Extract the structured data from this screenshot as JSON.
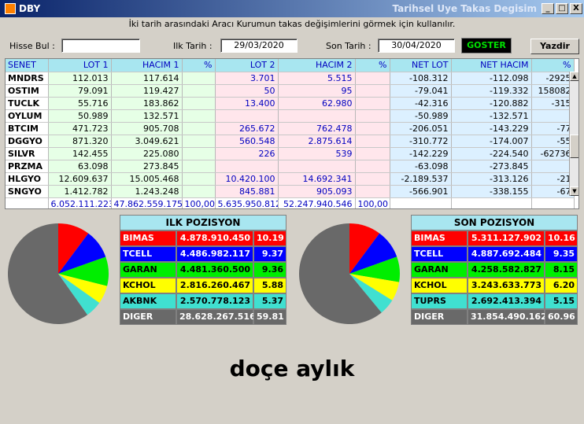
{
  "window": {
    "title": "DBY",
    "right_title": "Tarihsel Uye Takas Degisim",
    "min_label": "_",
    "max_label": "□",
    "close_label": "X"
  },
  "instruction": "İki tarih arasındaki  Aracı Kurumun takas değişimlerini görmek için kullanılır.",
  "controls": {
    "hisse_label": "Hisse Bul :",
    "hisse_value": "",
    "ilk_label": "Ilk Tarih :",
    "ilk_value": "29/03/2020",
    "son_label": "Son Tarih :",
    "son_value": "30/04/2020",
    "goster_label": "GOSTER",
    "yazdir_label": "Yazdir"
  },
  "grid": {
    "headers": [
      "SENET",
      "LOT 1",
      "HACIM 1",
      "%",
      "LOT 2",
      "HACIM 2",
      "%",
      "NET LOT",
      "NET HACIM",
      "%"
    ],
    "rows": [
      [
        "MNDRS",
        "112.013",
        "117.614",
        "",
        "3.701",
        "5.515",
        "",
        "-108.312",
        "-112.098",
        "-2925"
      ],
      [
        "OSTIM",
        "79.091",
        "119.427",
        "",
        "50",
        "95",
        "",
        "-79.041",
        "-119.332",
        "158082"
      ],
      [
        "TUCLK",
        "55.716",
        "183.862",
        "",
        "13.400",
        "62.980",
        "",
        "-42.316",
        "-120.882",
        "-315"
      ],
      [
        "OYLUM",
        "50.989",
        "132.571",
        "",
        "",
        "",
        "",
        "-50.989",
        "-132.571",
        ""
      ],
      [
        "BTCIM",
        "471.723",
        "905.708",
        "",
        "265.672",
        "762.478",
        "",
        "-206.051",
        "-143.229",
        "-77"
      ],
      [
        "DGGYO",
        "871.320",
        "3.049.621",
        "",
        "560.548",
        "2.875.614",
        "",
        "-310.772",
        "-174.007",
        "-55"
      ],
      [
        "SILVR",
        "142.455",
        "225.080",
        "",
        "226",
        "539",
        "",
        "-142.229",
        "-224.540",
        "-62736"
      ],
      [
        "PRZMA",
        "63.098",
        "273.845",
        "",
        "",
        "",
        "",
        "-63.098",
        "-273.845",
        ""
      ],
      [
        "HLGYO",
        "12.609.637",
        "15.005.468",
        "",
        "10.420.100",
        "14.692.341",
        "",
        "-2.189.537",
        "-313.126",
        "-21"
      ],
      [
        "SNGYO",
        "1.412.782",
        "1.243.248",
        "",
        "845.881",
        "905.093",
        "",
        "-566.901",
        "-338.155",
        "-67"
      ]
    ],
    "totals": [
      "",
      "6.052.111.223",
      "47.862.559.175",
      "100,00",
      "5.635.950.812",
      "52.247.940.546",
      "100,00",
      "",
      "",
      ""
    ]
  },
  "ilk_pozisyon": {
    "title": "ILK POZISYON",
    "rows": [
      {
        "name": "BIMAS",
        "value": "4.878.910.450",
        "pct": "10.19",
        "color": "#ff0000",
        "text": "#ffffff"
      },
      {
        "name": "TCELL",
        "value": "4.486.982.117",
        "pct": "9.37",
        "color": "#0000ff",
        "text": "#ffffff"
      },
      {
        "name": "GARAN",
        "value": "4.481.360.500",
        "pct": "9.36",
        "color": "#00ee00",
        "text": "#000000"
      },
      {
        "name": "KCHOL",
        "value": "2.816.260.467",
        "pct": "5.88",
        "color": "#ffff00",
        "text": "#000000"
      },
      {
        "name": "AKBNK",
        "value": "2.570.778.123",
        "pct": "5.37",
        "color": "#40e0d0",
        "text": "#000000"
      },
      {
        "name": "DIGER",
        "value": "28.628.267.516",
        "pct": "59.81",
        "color": "#696969",
        "text": "#ffffff"
      }
    ]
  },
  "son_pozisyon": {
    "title": "SON POZISYON",
    "rows": [
      {
        "name": "BIMAS",
        "value": "5.311.127.902",
        "pct": "10.16",
        "color": "#ff0000",
        "text": "#ffffff"
      },
      {
        "name": "TCELL",
        "value": "4.887.692.484",
        "pct": "9.35",
        "color": "#0000ff",
        "text": "#ffffff"
      },
      {
        "name": "GARAN",
        "value": "4.258.582.827",
        "pct": "8.15",
        "color": "#00ee00",
        "text": "#000000"
      },
      {
        "name": "KCHOL",
        "value": "3.243.633.773",
        "pct": "6.20",
        "color": "#ffff00",
        "text": "#000000"
      },
      {
        "name": "TUPRS",
        "value": "2.692.413.394",
        "pct": "5.15",
        "color": "#40e0d0",
        "text": "#000000"
      },
      {
        "name": "DIGER",
        "value": "31.854.490.162",
        "pct": "60.96",
        "color": "#696969",
        "text": "#ffffff"
      }
    ]
  },
  "footer_text": "doçe aylık"
}
